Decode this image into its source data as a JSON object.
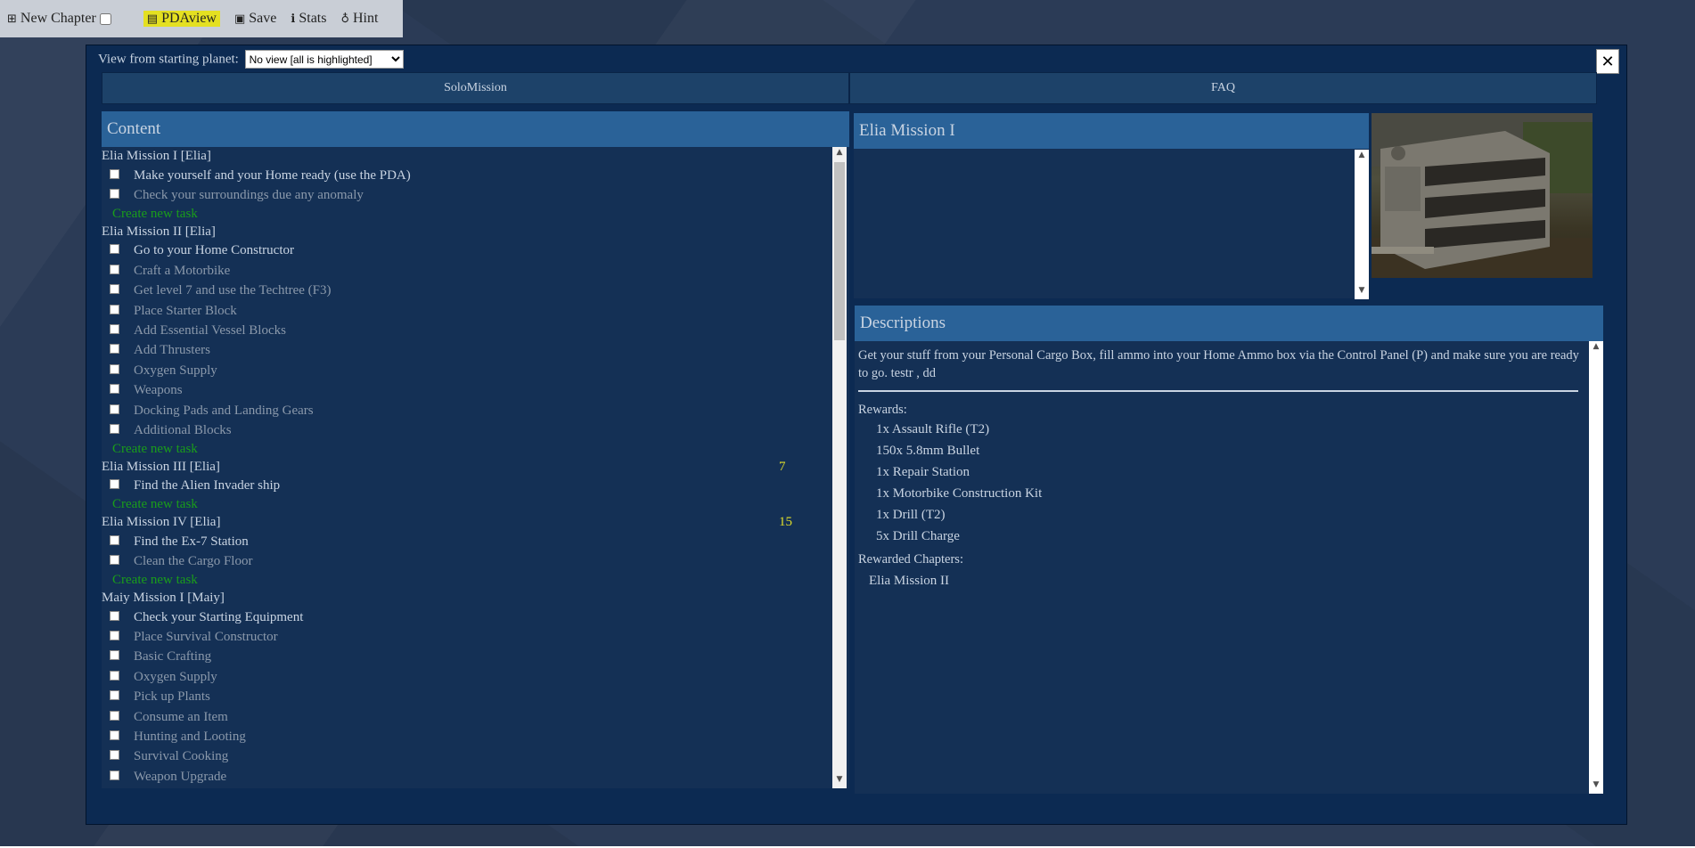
{
  "toolbar": {
    "new_chapter": "New Chapter",
    "pdaview": "PDAview",
    "save": "Save",
    "stats": "Stats",
    "hint": "Hint"
  },
  "view": {
    "label": "View from starting planet:",
    "selected": "No view [all is highlighted]"
  },
  "close_glyph": "✕",
  "tabs": [
    "SoloMission",
    "FAQ"
  ],
  "content": {
    "header": "Content",
    "create_label": "Create new task",
    "chapters": [
      {
        "title": "Elia Mission I [Elia]",
        "count": "",
        "tasks": [
          {
            "label": "Make yourself and your Home ready (use the PDA)",
            "bright": true
          },
          {
            "label": "Check your surroundings due any anomaly",
            "bright": false
          }
        ],
        "create": true
      },
      {
        "title": "Elia Mission II [Elia]",
        "count": "",
        "tasks": [
          {
            "label": "Go to your Home Constructor",
            "bright": true
          },
          {
            "label": "Craft a Motorbike",
            "bright": false
          },
          {
            "label": "Get level 7 and use the Techtree (F3)",
            "bright": false
          },
          {
            "label": "Place Starter Block",
            "bright": false
          },
          {
            "label": "Add Essential Vessel Blocks",
            "bright": false
          },
          {
            "label": "Add Thrusters",
            "bright": false
          },
          {
            "label": "Oxygen Supply",
            "bright": false
          },
          {
            "label": "Weapons",
            "bright": false
          },
          {
            "label": "Docking Pads and Landing Gears",
            "bright": false
          },
          {
            "label": "Additional Blocks",
            "bright": false
          }
        ],
        "create": true
      },
      {
        "title": "Elia Mission III [Elia]",
        "count": "7",
        "tasks": [
          {
            "label": "Find the Alien Invader ship",
            "bright": true
          }
        ],
        "create": true
      },
      {
        "title": "Elia Mission IV [Elia]",
        "count": "15",
        "tasks": [
          {
            "label": "Find the Ex-7 Station",
            "bright": true
          },
          {
            "label": "Clean the Cargo Floor",
            "bright": false
          }
        ],
        "create": true
      },
      {
        "title": "Maiy Mission I [Maiy]",
        "count": "",
        "tasks": [
          {
            "label": "Check your Starting Equipment",
            "bright": true
          },
          {
            "label": "Place Survival Constructor",
            "bright": false
          },
          {
            "label": "Basic Crafting",
            "bright": false
          },
          {
            "label": "Oxygen Supply",
            "bright": false
          },
          {
            "label": "Pick up Plants",
            "bright": false
          },
          {
            "label": "Consume an Item",
            "bright": false
          },
          {
            "label": "Hunting and Looting",
            "bright": false
          },
          {
            "label": "Survival Cooking",
            "bright": false
          },
          {
            "label": "Weapon Upgrade",
            "bright": false
          }
        ],
        "create": false
      }
    ]
  },
  "mission": {
    "title": "Elia Mission I"
  },
  "descriptions": {
    "header": "Descriptions",
    "text": "Get your stuff from your Personal Cargo Box, fill ammo into your Home Ammo box via the Control Panel (P) and make sure you are ready to go. testr , dd",
    "rewards_label": "Rewards:",
    "rewards": [
      "1x Assault Rifle (T2)",
      "150x 5.8mm Bullet",
      "1x Repair Station",
      "1x Motorbike Construction Kit",
      "1x Drill (T2)",
      "5x Drill Charge"
    ],
    "rewarded_chapters_label": "Rewarded Chapters:",
    "rewarded_chapters": [
      "Elia Mission II"
    ]
  },
  "colors": {
    "highlight": "#e4e021",
    "header_bg": "#2a6298",
    "panel_bg": "#143055",
    "create_task": "#1a9e1a",
    "count": "#e0de2a"
  }
}
